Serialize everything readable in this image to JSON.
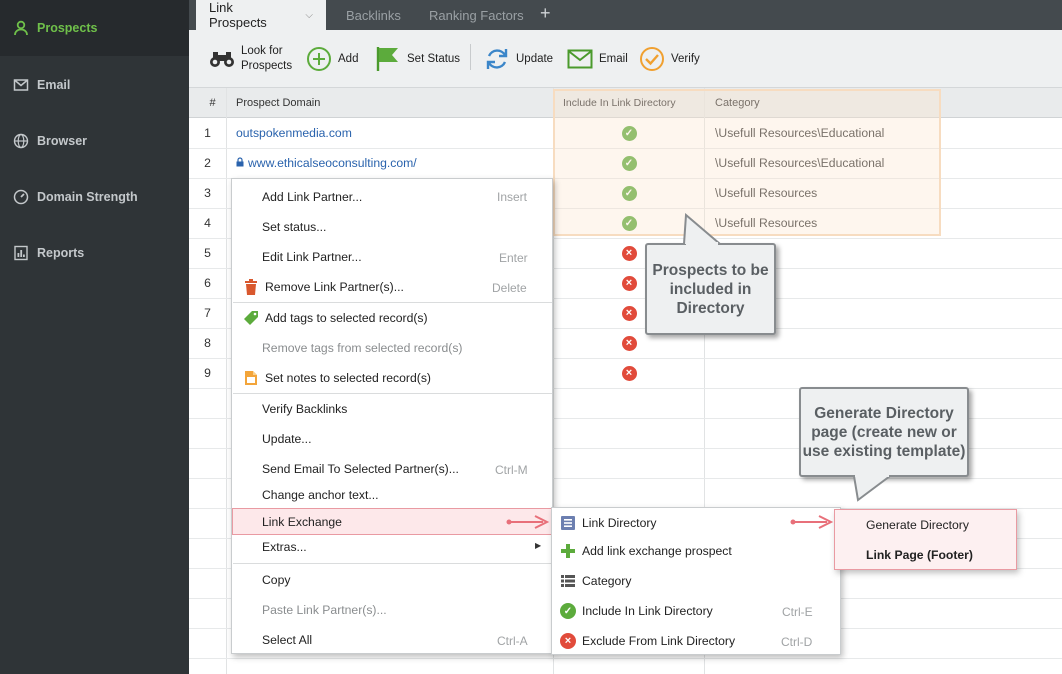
{
  "sidebar": {
    "items": [
      {
        "label": "Prospects",
        "icon": "user-icon"
      },
      {
        "label": "Email",
        "icon": "envelope-icon"
      },
      {
        "label": "Browser",
        "icon": "globe-icon"
      },
      {
        "label": "Domain Strength",
        "icon": "gauge-icon"
      },
      {
        "label": "Reports",
        "icon": "report-icon"
      }
    ]
  },
  "tabs": {
    "items": [
      {
        "label": "Link Prospects"
      },
      {
        "label": "Backlinks"
      },
      {
        "label": "Ranking Factors"
      }
    ],
    "add_label": "+"
  },
  "toolbar": {
    "look_for_line1": "Look for",
    "look_for_line2": "Prospects",
    "add": "Add",
    "set_status": "Set Status",
    "update": "Update",
    "email": "Email",
    "verify": "Verify"
  },
  "grid": {
    "headers": {
      "num": "#",
      "domain": "Prospect Domain",
      "include": "Include In Link Directory",
      "category": "Category"
    },
    "rows": [
      {
        "num": "1",
        "domain": "outspokenmedia.com",
        "secure": false,
        "category": "\\Usefull Resources\\Educational",
        "included": true
      },
      {
        "num": "2",
        "domain": "www.ethicalseoconsulting.com/",
        "secure": true,
        "category": "\\Usefull Resources\\Educational",
        "included": true
      },
      {
        "num": "3",
        "domain": "",
        "secure": false,
        "category": "\\Usefull Resources",
        "included": true
      },
      {
        "num": "4",
        "domain": "",
        "secure": false,
        "category": "\\Usefull Resources",
        "included": true
      },
      {
        "num": "5",
        "domain": "",
        "secure": false,
        "category": "",
        "included": false
      },
      {
        "num": "6",
        "domain": "",
        "secure": false,
        "category": "",
        "included": false
      },
      {
        "num": "7",
        "domain": "",
        "secure": false,
        "category": "",
        "included": false
      },
      {
        "num": "8",
        "domain": "",
        "secure": false,
        "category": "",
        "included": false
      },
      {
        "num": "9",
        "domain": "",
        "secure": false,
        "category": "",
        "included": false
      }
    ]
  },
  "context_menu": {
    "items": [
      {
        "label": "Add Link Partner...",
        "shortcut": "Insert"
      },
      {
        "label": "Set status...",
        "shortcut": ""
      },
      {
        "label": "Edit Link Partner...",
        "shortcut": "Enter"
      },
      {
        "label": "Remove Link Partner(s)...",
        "shortcut": "Delete"
      },
      {
        "label": "Add tags to selected record(s)",
        "shortcut": ""
      },
      {
        "label": "Remove tags from selected record(s)",
        "shortcut": ""
      },
      {
        "label": "Set notes to selected record(s)",
        "shortcut": ""
      },
      {
        "label": "Verify Backlinks",
        "shortcut": ""
      },
      {
        "label": "Update...",
        "shortcut": ""
      },
      {
        "label": "Send Email To Selected Partner(s)...",
        "shortcut": "Ctrl-M"
      },
      {
        "label": "Change anchor text...",
        "shortcut": ""
      },
      {
        "label": "Link Exchange",
        "shortcut": ""
      },
      {
        "label": "Extras...",
        "shortcut": ""
      },
      {
        "label": "Copy",
        "shortcut": ""
      },
      {
        "label": "Paste Link Partner(s)...",
        "shortcut": ""
      },
      {
        "label": "Select All",
        "shortcut": "Ctrl-A"
      }
    ]
  },
  "submenu": {
    "items": [
      {
        "label": "Link Directory",
        "shortcut": ""
      },
      {
        "label": "Add link exchange prospect",
        "shortcut": ""
      },
      {
        "label": "Category",
        "shortcut": ""
      },
      {
        "label": "Include In Link Directory",
        "shortcut": "Ctrl-E"
      },
      {
        "label": "Exclude From Link Directory",
        "shortcut": "Ctrl-D"
      }
    ]
  },
  "submenu2": {
    "items": [
      {
        "label": "Generate Directory"
      },
      {
        "label": "Link Page (Footer)"
      }
    ]
  },
  "callouts": {
    "prospects": "Prospects to be included in Directory",
    "generate": "Generate Directory page (create new or use existing template)"
  },
  "colors": {
    "accent_green": "#6fc04a",
    "link_blue": "#2a63ad",
    "check_green": "#5cab3c",
    "cross_red": "#e14b3b",
    "arrow_red": "#e8707a"
  }
}
